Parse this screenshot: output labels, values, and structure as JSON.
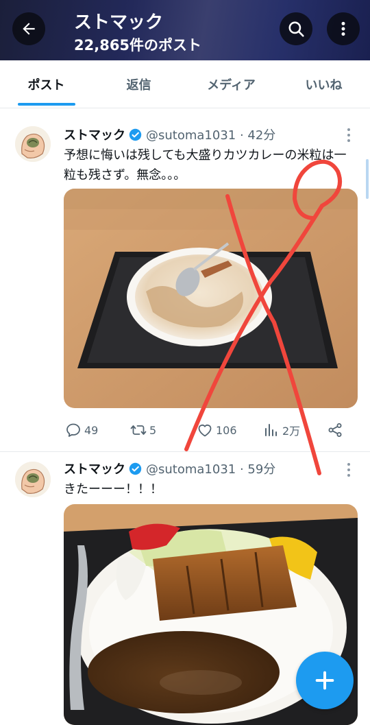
{
  "header": {
    "title": "ストマック",
    "post_count": "22,865件のポスト"
  },
  "tabs": [
    {
      "label": "ポスト",
      "active": true
    },
    {
      "label": "返信",
      "active": false
    },
    {
      "label": "メディア",
      "active": false
    },
    {
      "label": "いいね",
      "active": false
    }
  ],
  "posts": [
    {
      "username": "ストマック",
      "handle_time": "@sutoma1031 · 42分",
      "text": "予想に悔いは残しても大盛りカツカレーの米粒は一粒も残さず。無念。。。",
      "actions": {
        "replies": "49",
        "reposts": "5",
        "likes": "106",
        "views": "2万"
      }
    },
    {
      "username": "ストマック",
      "handle_time": "@sutoma1031 · 59分",
      "text": "きたーーー！！！"
    }
  ],
  "colors": {
    "accent": "#1d9bf0",
    "annotation_red": "#f0463c"
  }
}
